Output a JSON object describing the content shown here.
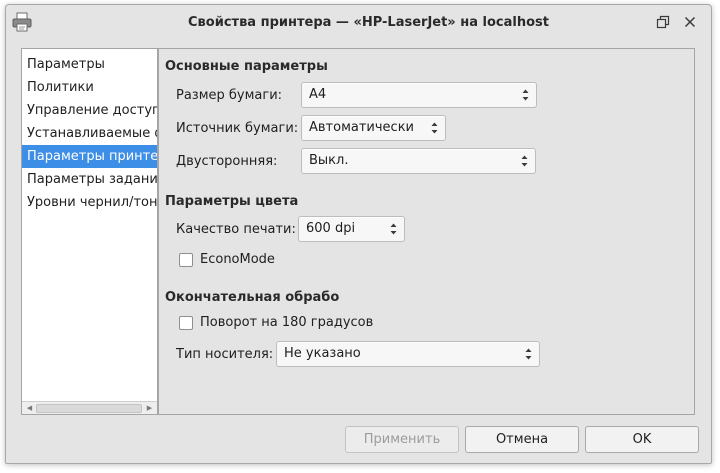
{
  "window": {
    "title": "Свойства принтера — «HP-LaserJet» на localhost",
    "icons": {
      "app": "printer-icon",
      "restore": "restore-icon",
      "close": "close-icon"
    }
  },
  "sidebar": {
    "items": [
      {
        "label": "Параметры",
        "selected": false
      },
      {
        "label": "Политики",
        "selected": false
      },
      {
        "label": "Управление доступом",
        "selected": false
      },
      {
        "label": "Устанавливаемые функции",
        "selected": false
      },
      {
        "label": "Параметры принтера",
        "selected": true
      },
      {
        "label": "Параметры задания",
        "selected": false
      },
      {
        "label": "Уровни чернил/тонера",
        "selected": false
      }
    ]
  },
  "basic": {
    "title": "Основные параметры",
    "paper_size_label": "Размер бумаги:",
    "paper_size_value": "A4",
    "paper_source_label": "Источник бумаги:",
    "paper_source_value": "Автоматически",
    "duplex_label": "Двусторонняя:",
    "duplex_value": "Выкл."
  },
  "color": {
    "title": "Параметры цвета",
    "quality_label": "Качество печати:",
    "quality_value": "600 dpi",
    "economode_label": "EconoMode",
    "economode_checked": false
  },
  "finishing": {
    "title": "Окончательная обрабо",
    "rotate_label": "Поворот на 180 градусов",
    "rotate_checked": false,
    "media_label": "Тип носителя:",
    "media_value": "Не указано"
  },
  "buttons": {
    "apply": "Применить",
    "cancel": "Отмена",
    "ok": "OK"
  },
  "colors": {
    "selection": "#3d8ee6",
    "window_bg": "#e4e4e4"
  }
}
